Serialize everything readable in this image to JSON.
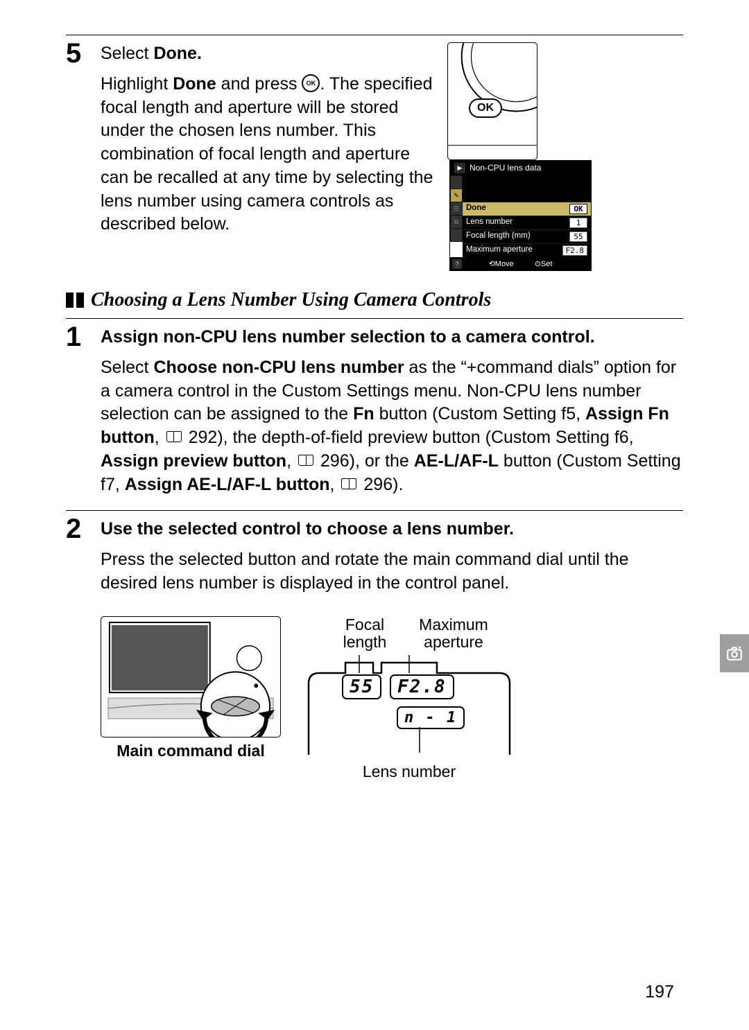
{
  "step5": {
    "number": "5",
    "title_light": "Select ",
    "title_bold": "Done",
    "title_suffix": ".",
    "para_prefix": "Highlight ",
    "para_bold": "Done",
    "para_mid": " and press ",
    "para_after_ok": ". The specified focal length and aperture will be stored under the chosen lens number.  This combination of focal length and aperture can be recalled at any time by selecting the lens number using camera controls as described below.",
    "ok_label": "OK"
  },
  "subsection_title": "Choosing a Lens Number Using Camera Controls",
  "menu": {
    "title": "Non-CPU lens data",
    "done_label": "Done",
    "done_value": "OK",
    "row_lens_label": "Lens number",
    "row_lens_value": "1",
    "row_focal_label": "Focal length (mm)",
    "row_focal_value": "55",
    "row_ap_label": "Maximum aperture",
    "row_ap_value": "F2.8",
    "footer_move": "Move",
    "footer_set": "Set"
  },
  "step1": {
    "number": "1",
    "title": "Assign non-CPU lens number selection to a camera control.",
    "p1_a": "Select ",
    "p1_b": "Choose non-CPU lens number",
    "p1_c": " as the “+command dials” option for a camera control in the Custom Settings menu.  Non-CPU lens number selection can be assigned to the ",
    "p1_d": "Fn",
    "p1_e": " button (Custom Setting f5, ",
    "p1_f": "Assign Fn button",
    "p1_g": ", ",
    "p1_ref1": "292",
    "p1_h": "), the depth-of-field preview button (Custom Setting f6, ",
    "p1_i": "Assign preview button",
    "p1_j": ", ",
    "p1_ref2": "296",
    "p1_k": "), or the ",
    "p1_l": "AE-L/AF-L",
    "p1_m": " button (Custom Setting f7, ",
    "p1_n": "Assign AE-L/AF-L button",
    "p1_o": ", ",
    "p1_ref3": "296",
    "p1_p": ")."
  },
  "step2": {
    "number": "2",
    "title": "Use the selected control to choose a lens number.",
    "para": "Press the selected button and rotate the main command dial until the desired lens number is displayed in the control panel."
  },
  "diagram": {
    "main_dial_caption": "Main command dial",
    "focal_label_1": "Focal",
    "focal_label_2": "length",
    "ap_label_1": "Maximum",
    "ap_label_2": "aperture",
    "lens_label": "Lens number",
    "seg_focal": "55",
    "seg_ap": "F2.8",
    "seg_lens": "n - 1"
  },
  "page_number": "197"
}
